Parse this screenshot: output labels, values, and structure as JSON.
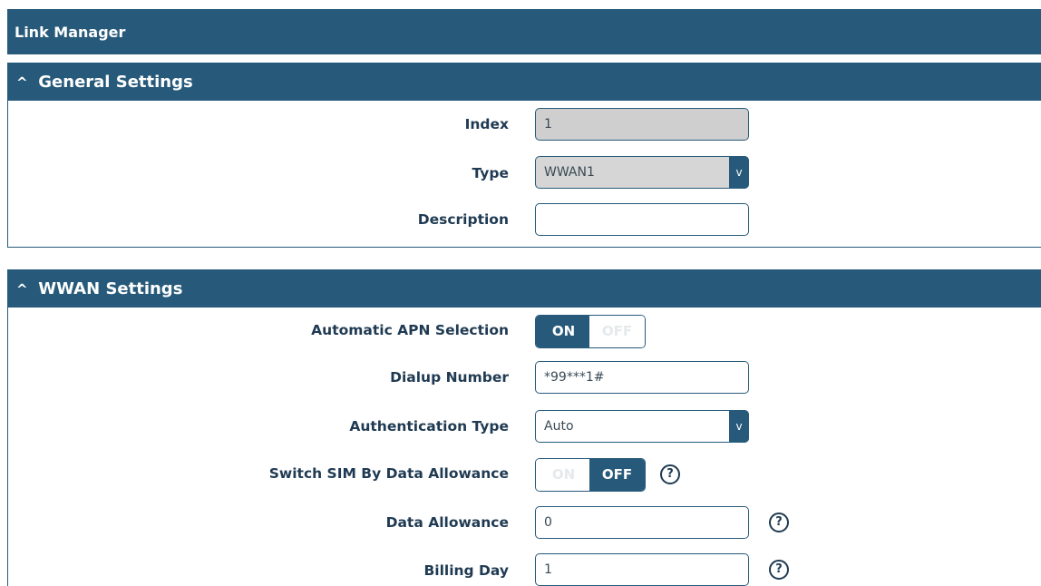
{
  "page": {
    "title": "Link Manager"
  },
  "general": {
    "header": "General Settings",
    "index": {
      "label": "Index",
      "value": "1"
    },
    "type": {
      "label": "Type",
      "value": "WWAN1",
      "arrow": "v"
    },
    "description": {
      "label": "Description",
      "value": ""
    }
  },
  "wwan": {
    "header": "WWAN Settings",
    "apn": {
      "label": "Automatic APN Selection",
      "on": "ON",
      "off": "OFF",
      "state": "on"
    },
    "dialup": {
      "label": "Dialup Number",
      "value": "*99***1#"
    },
    "auth": {
      "label": "Authentication Type",
      "value": "Auto",
      "arrow": "v"
    },
    "switch_sim": {
      "label": "Switch SIM By Data Allowance",
      "on": "ON",
      "off": "OFF",
      "state": "off",
      "help": "?"
    },
    "data_allowance": {
      "label": "Data Allowance",
      "value": "0",
      "help": "?"
    },
    "billing_day": {
      "label": "Billing Day",
      "value": "1",
      "help": "?"
    }
  },
  "icons": {
    "collapse": "^"
  },
  "colors": {
    "primary": "#275a7a",
    "readonly_bg": "#cfcfcf",
    "text": "#1f3a52"
  }
}
